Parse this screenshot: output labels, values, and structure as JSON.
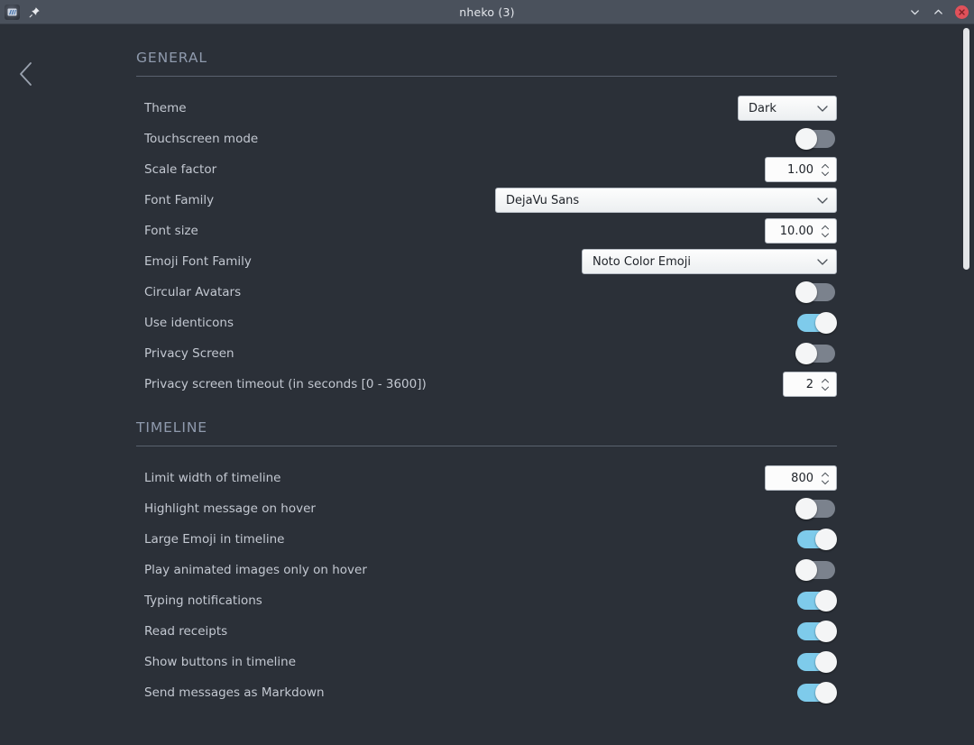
{
  "titlebar": {
    "title": "nheko (3)",
    "app_icon": "app-logo-icon",
    "pin_icon": "pin-icon",
    "minimize_icon": "chevron-down-icon",
    "maximize_icon": "chevron-up-icon",
    "close_icon": "close-icon",
    "bg_color": "#4a515c",
    "close_color": "#e0515a"
  },
  "nav": {
    "back_label": "back-icon"
  },
  "theme": {
    "window_bg": "#2b3038",
    "text_color": "#c3c8d1",
    "header_color": "#8f9aad",
    "toggle_on_color": "#7ecbeb",
    "toggle_off_color": "#7b828d",
    "control_bg": "#fcfcfc",
    "control_text": "#20242a",
    "rule_color": "#5a626f",
    "scrollbar_color": "#e3e5e8"
  },
  "sections": [
    {
      "title": "GENERAL",
      "rows": [
        {
          "label": "Theme",
          "type": "combo",
          "value": "Dark",
          "size": "sm"
        },
        {
          "label": "Touchscreen mode",
          "type": "toggle",
          "value": false
        },
        {
          "label": "Scale factor",
          "type": "spin",
          "value": "1.00",
          "size": "80"
        },
        {
          "label": "Font Family",
          "type": "combo",
          "value": "DejaVu Sans",
          "size": "lg"
        },
        {
          "label": "Font size",
          "type": "spin",
          "value": "10.00",
          "size": "80"
        },
        {
          "label": "Emoji Font Family",
          "type": "combo",
          "value": "Noto Color Emoji",
          "size": "md"
        },
        {
          "label": "Circular Avatars",
          "type": "toggle",
          "value": false
        },
        {
          "label": "Use identicons",
          "type": "toggle",
          "value": true
        },
        {
          "label": "Privacy Screen",
          "type": "toggle",
          "value": false
        },
        {
          "label": "Privacy screen timeout (in seconds [0 - 3600])",
          "type": "spin",
          "value": "2",
          "size": "60"
        }
      ]
    },
    {
      "title": "TIMELINE",
      "rows": [
        {
          "label": "Limit width of timeline",
          "type": "spin",
          "value": "800",
          "size": "80"
        },
        {
          "label": "Highlight message on hover",
          "type": "toggle",
          "value": false
        },
        {
          "label": "Large Emoji in timeline",
          "type": "toggle",
          "value": true
        },
        {
          "label": "Play animated images only on hover",
          "type": "toggle",
          "value": false
        },
        {
          "label": "Typing notifications",
          "type": "toggle",
          "value": true
        },
        {
          "label": "Read receipts",
          "type": "toggle",
          "value": true
        },
        {
          "label": "Show buttons in timeline",
          "type": "toggle",
          "value": true
        },
        {
          "label": "Send messages as Markdown",
          "type": "toggle",
          "value": true
        }
      ]
    }
  ]
}
